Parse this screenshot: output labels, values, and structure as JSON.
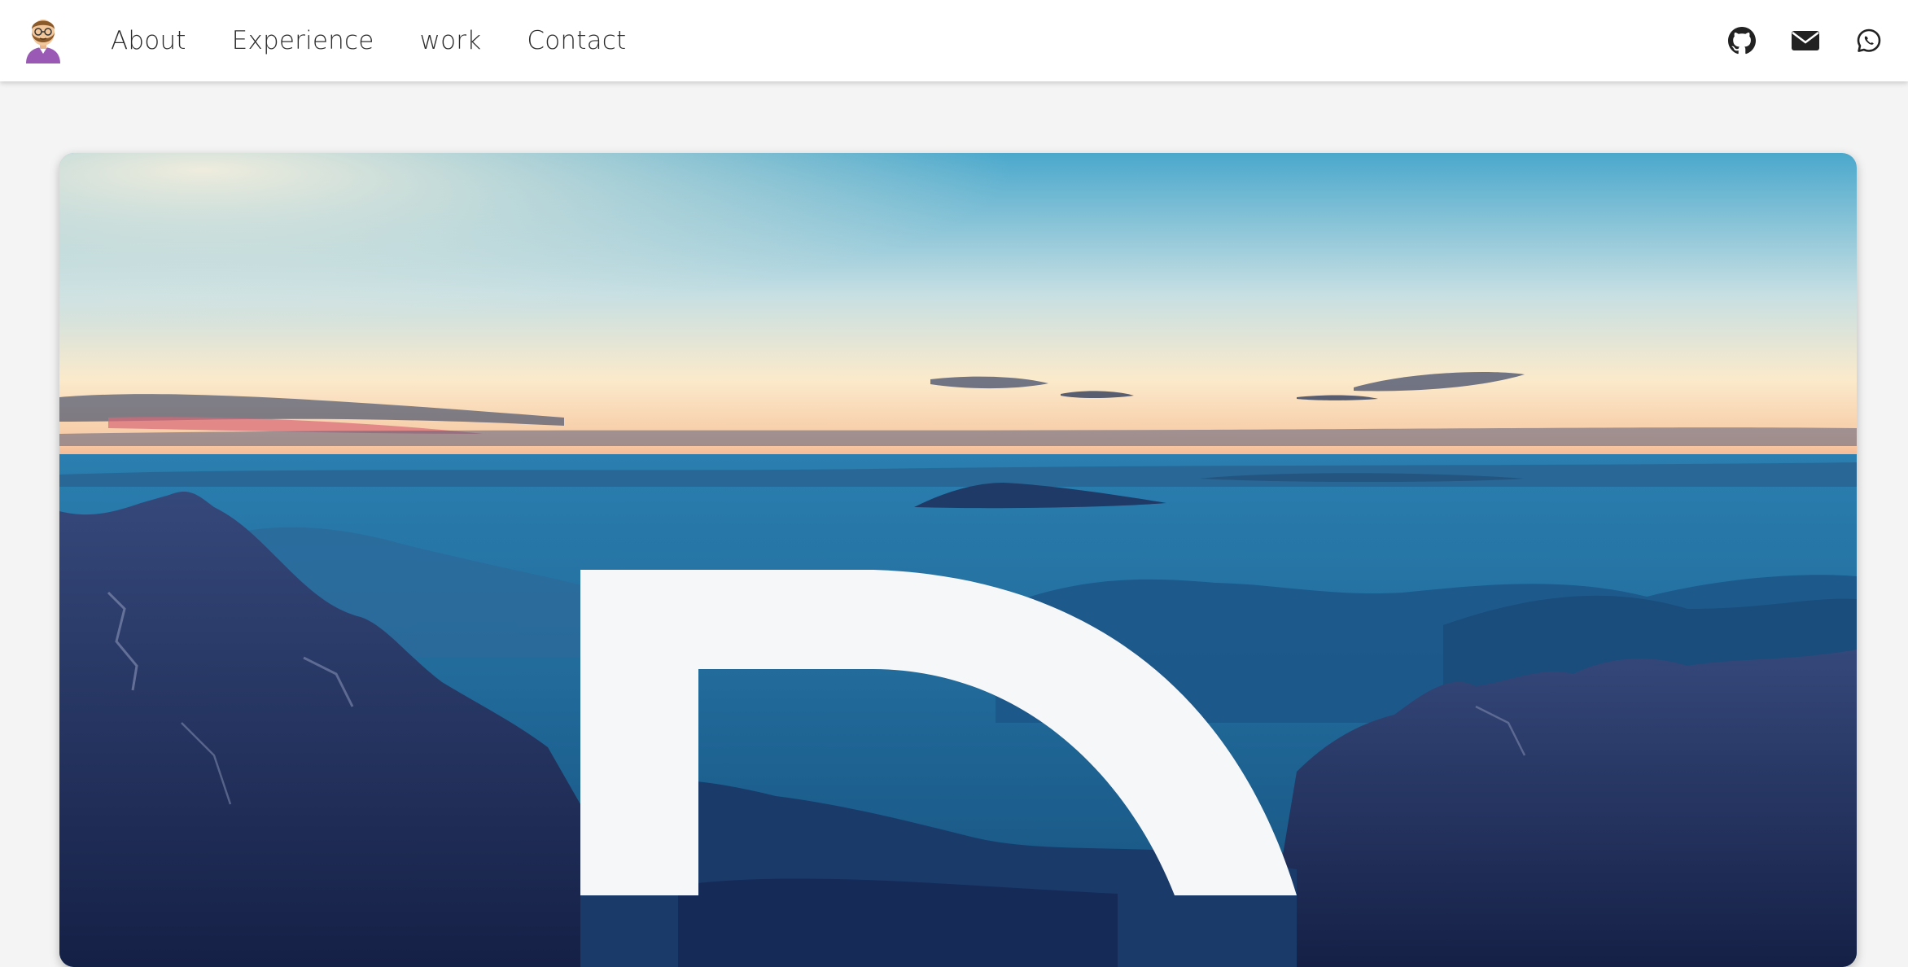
{
  "nav": {
    "links": [
      {
        "label": "About"
      },
      {
        "label": "Experience"
      },
      {
        "label": "work"
      },
      {
        "label": "Contact"
      }
    ],
    "icons": [
      "github-icon",
      "mail-icon",
      "whatsapp-icon"
    ]
  },
  "colors": {
    "nav_bg": "#ffffff",
    "page_bg": "#f4f4f4",
    "sky_top": "#3aa6cf",
    "sky_glow": "#fbe9c8",
    "sunset_pink": "#f08b7d",
    "mountain_dark": "#1c2a55",
    "mist_blue": "#1f6a9a"
  }
}
